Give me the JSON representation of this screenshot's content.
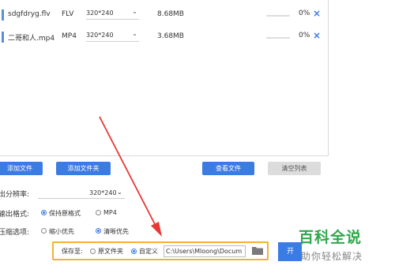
{
  "files": [
    {
      "name": "sdgfdryg.flv",
      "format": "FLV",
      "resolution": "320*240",
      "size": "8.68MB",
      "progress_pct": 0,
      "progress_text": "0%"
    },
    {
      "name": "二哥和人.mp4",
      "format": "MP4",
      "resolution": "320*240",
      "size": "3.68MB",
      "progress_pct": 0,
      "progress_text": "0%"
    }
  ],
  "buttons": {
    "add_file": "添加文件",
    "add_folder": "添加文件夹",
    "view_files": "查看文件",
    "clear_list": "清空列表",
    "start": "开"
  },
  "settings": {
    "resolution_label": "出分辨率:",
    "resolution_value": "320*240",
    "output_format_label": "输出格式:",
    "format_options": [
      "保持原格式",
      "MP4"
    ],
    "format_selected": 0,
    "compress_label": "压缩选项:",
    "compress_options": [
      "缩小优先",
      "清晰优先"
    ],
    "compress_selected": 1
  },
  "save": {
    "label": "保存至:",
    "options": [
      "原文件夹",
      "自定义"
    ],
    "selected": 1,
    "path": "C:\\Users\\Mloong\\Docum"
  },
  "watermark": {
    "title": "百科全说",
    "subtitle": "助你轻松解决"
  },
  "colors": {
    "accent": "#3b7be4",
    "highlight_border": "#f2b233",
    "annotation_arrow": "#e53935",
    "watermark_green": "#2da84a"
  }
}
